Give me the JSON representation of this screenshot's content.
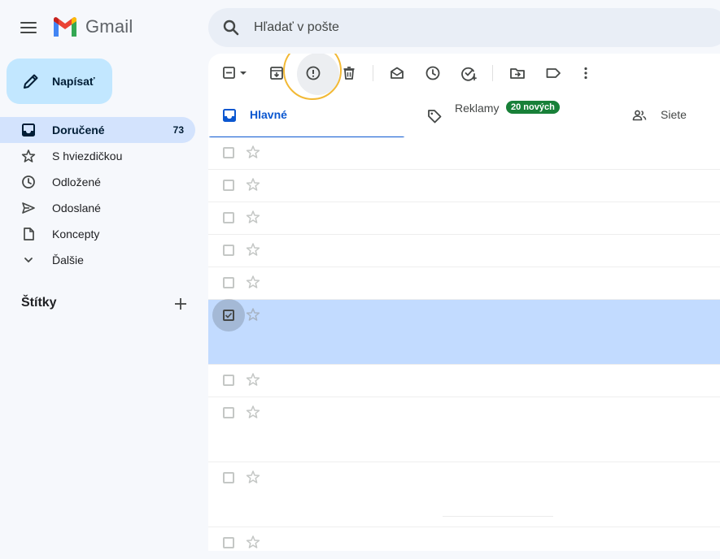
{
  "app": {
    "name": "Gmail"
  },
  "search": {
    "placeholder": "Hľadať v pošte"
  },
  "compose": {
    "label": "Napísať"
  },
  "nav": {
    "items": [
      {
        "label": "Doručené",
        "count": "73",
        "icon": "inbox-icon",
        "active": true
      },
      {
        "label": "S hviezdičkou",
        "count": "",
        "icon": "star-icon"
      },
      {
        "label": "Odložené",
        "count": "",
        "icon": "clock-icon"
      },
      {
        "label": "Odoslané",
        "count": "",
        "icon": "send-icon"
      },
      {
        "label": "Koncepty",
        "count": "",
        "icon": "draft-icon"
      },
      {
        "label": "Ďalšie",
        "count": "",
        "icon": "chevron-down-icon"
      }
    ]
  },
  "labels": {
    "heading": "Štítky"
  },
  "toolbar": {
    "icons": [
      "select-checkbox-icon",
      "archive-icon",
      "report-spam-icon",
      "delete-icon",
      "mark-read-icon",
      "snooze-icon",
      "add-task-icon",
      "move-to-icon",
      "label-icon",
      "more-vert-icon"
    ],
    "highlighted": "report-spam-icon"
  },
  "tabs": [
    {
      "label": "Hlavné",
      "icon": "inbox-icon",
      "active": true
    },
    {
      "label": "Reklamy",
      "icon": "tag-icon",
      "badge": "20 nových"
    },
    {
      "label": "Siete",
      "icon": "people-icon"
    }
  ],
  "colors": {
    "accent": "#0b57d0",
    "compose_bg": "#c2e7ff",
    "nav_active_bg": "#d3e3fd",
    "selected_row_bg": "#c2dbff",
    "promo_badge": "#188038",
    "highlight_ring": "#f2b935"
  },
  "messages": [
    {
      "selected": false
    },
    {
      "selected": false
    },
    {
      "selected": false
    },
    {
      "selected": false
    },
    {
      "selected": false
    },
    {
      "selected": true
    },
    {
      "selected": false
    },
    {
      "selected": false
    },
    {
      "selected": false
    },
    {
      "selected": false
    }
  ]
}
